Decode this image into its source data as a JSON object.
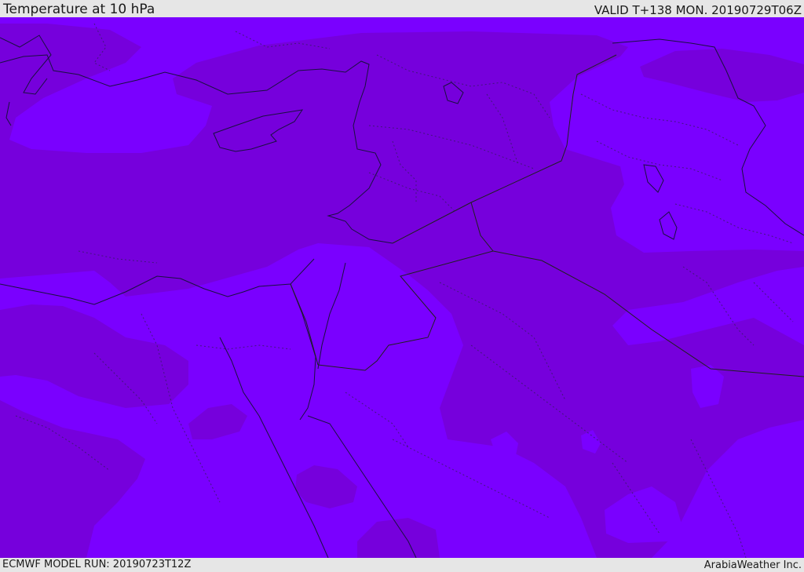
{
  "header": {
    "title": "Temperature at 10 hPa",
    "valid": "VALID T+138 MON. 20190729T06Z"
  },
  "footer": {
    "model_run": "ECMWF MODEL RUN: 20190723T12Z",
    "brand": "ArabiaWeather Inc."
  },
  "map": {
    "colors": {
      "warm_band": "#7a00ff",
      "cool_band": "#7600dc",
      "coastline": "#1a1040",
      "border": "#202020"
    }
  }
}
